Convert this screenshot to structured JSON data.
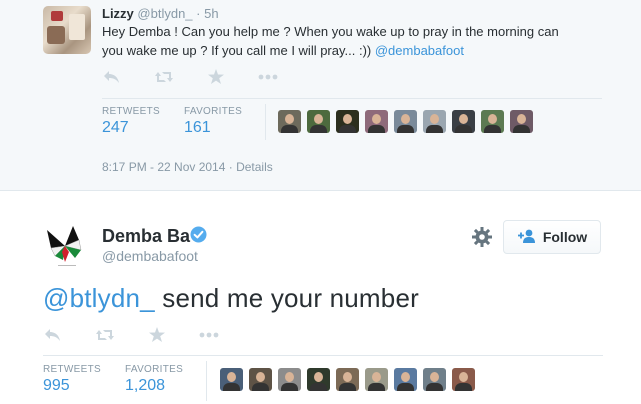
{
  "top_tweet": {
    "name": "Lizzy",
    "handle": "@btlydn_",
    "separator": "·",
    "time": "5h",
    "text_line1": "Hey Demba ! Can you help me ? When you wake up to pray in the morning can",
    "text_line2_plain": "you wake me up ? If you call me I will pray...  :)) ",
    "text_line2_mention": "@dembabafoot",
    "retweets_label": "RETWEETS",
    "retweets_value": "247",
    "favorites_label": "FAVORITES",
    "favorites_value": "161",
    "timestamp": "8:17 PM - 22 Nov 2014",
    "separator2": " · ",
    "details_label": "Details"
  },
  "main_tweet": {
    "name": "Demba Ba",
    "handle": "@dembabafoot",
    "follow_label": "Follow",
    "text_mention": "@btlydn_",
    "text_plain": " send me your number",
    "retweets_label": "RETWEETS",
    "retweets_value": "995",
    "favorites_label": "FAVORITES",
    "favorites_value": "1,208"
  },
  "colors": {
    "link": "#3b94d9",
    "muted": "#8899a6",
    "icon_grey": "#ccd6dd",
    "verified_blue": "#55acee"
  },
  "icons": [
    "reply-icon",
    "retweet-icon",
    "favorite-icon",
    "more-icon",
    "gear-icon",
    "follow-person-icon",
    "verified-badge-icon"
  ]
}
